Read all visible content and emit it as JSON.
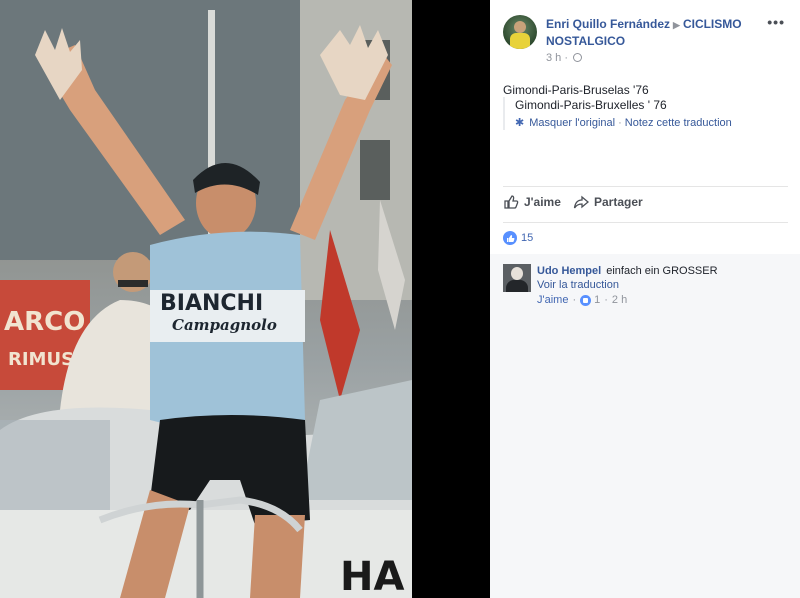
{
  "post": {
    "author": "Enri Quillo Fernández",
    "group": "CICLISMO NOSTALGICO",
    "time": "3 h",
    "text": "Gimondi-Paris-Bruselas '76",
    "translation": "Gimondi-Paris-Bruxelles ' 76",
    "hide_original": "Masquer l'original",
    "rate_translation": "Notez cette traduction",
    "separator": "·"
  },
  "actions": {
    "like": "J'aime",
    "share": "Partager"
  },
  "reactions": {
    "count": "15"
  },
  "comments": [
    {
      "author": "Udo Hempel",
      "text": "einfach ein GROSSER",
      "see_translation": "Voir la traduction",
      "like": "J'aime",
      "likes": "1",
      "time": "2 h"
    }
  ],
  "icons": {
    "more": "more-icon",
    "globe": "globe-icon",
    "gear": "gear-icon",
    "like": "thumbs-up-icon",
    "share": "share-arrow-icon"
  },
  "colors": {
    "link": "#365899",
    "accent": "#4267b2",
    "like_bubble": "#5890ff"
  },
  "photo": {
    "jersey_brand": "BIANCHI",
    "jersey_sponsor": "Campagnolo"
  }
}
